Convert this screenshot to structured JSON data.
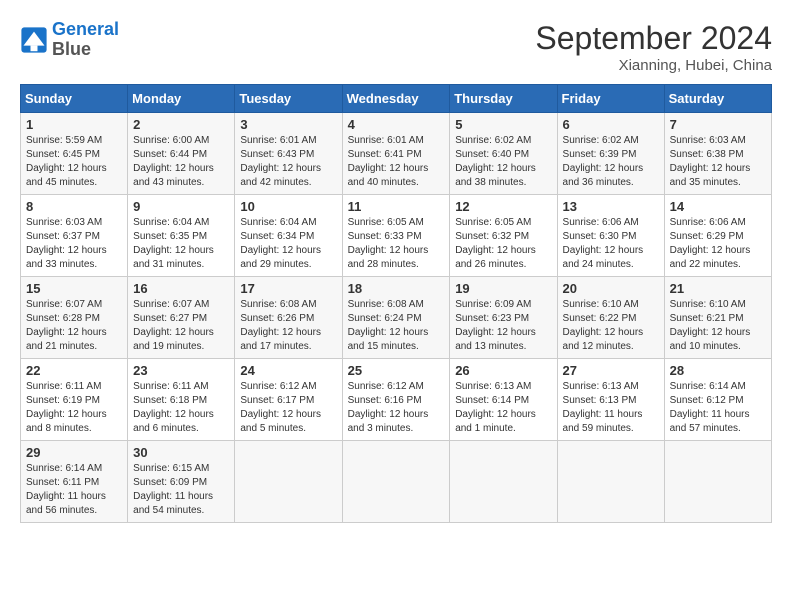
{
  "header": {
    "logo_line1": "General",
    "logo_line2": "Blue",
    "month_title": "September 2024",
    "location": "Xianning, Hubei, China"
  },
  "weekdays": [
    "Sunday",
    "Monday",
    "Tuesday",
    "Wednesday",
    "Thursday",
    "Friday",
    "Saturday"
  ],
  "weeks": [
    [
      {
        "day": "1",
        "sunrise": "Sunrise: 5:59 AM",
        "sunset": "Sunset: 6:45 PM",
        "daylight": "Daylight: 12 hours and 45 minutes."
      },
      {
        "day": "2",
        "sunrise": "Sunrise: 6:00 AM",
        "sunset": "Sunset: 6:44 PM",
        "daylight": "Daylight: 12 hours and 43 minutes."
      },
      {
        "day": "3",
        "sunrise": "Sunrise: 6:01 AM",
        "sunset": "Sunset: 6:43 PM",
        "daylight": "Daylight: 12 hours and 42 minutes."
      },
      {
        "day": "4",
        "sunrise": "Sunrise: 6:01 AM",
        "sunset": "Sunset: 6:41 PM",
        "daylight": "Daylight: 12 hours and 40 minutes."
      },
      {
        "day": "5",
        "sunrise": "Sunrise: 6:02 AM",
        "sunset": "Sunset: 6:40 PM",
        "daylight": "Daylight: 12 hours and 38 minutes."
      },
      {
        "day": "6",
        "sunrise": "Sunrise: 6:02 AM",
        "sunset": "Sunset: 6:39 PM",
        "daylight": "Daylight: 12 hours and 36 minutes."
      },
      {
        "day": "7",
        "sunrise": "Sunrise: 6:03 AM",
        "sunset": "Sunset: 6:38 PM",
        "daylight": "Daylight: 12 hours and 35 minutes."
      }
    ],
    [
      {
        "day": "8",
        "sunrise": "Sunrise: 6:03 AM",
        "sunset": "Sunset: 6:37 PM",
        "daylight": "Daylight: 12 hours and 33 minutes."
      },
      {
        "day": "9",
        "sunrise": "Sunrise: 6:04 AM",
        "sunset": "Sunset: 6:35 PM",
        "daylight": "Daylight: 12 hours and 31 minutes."
      },
      {
        "day": "10",
        "sunrise": "Sunrise: 6:04 AM",
        "sunset": "Sunset: 6:34 PM",
        "daylight": "Daylight: 12 hours and 29 minutes."
      },
      {
        "day": "11",
        "sunrise": "Sunrise: 6:05 AM",
        "sunset": "Sunset: 6:33 PM",
        "daylight": "Daylight: 12 hours and 28 minutes."
      },
      {
        "day": "12",
        "sunrise": "Sunrise: 6:05 AM",
        "sunset": "Sunset: 6:32 PM",
        "daylight": "Daylight: 12 hours and 26 minutes."
      },
      {
        "day": "13",
        "sunrise": "Sunrise: 6:06 AM",
        "sunset": "Sunset: 6:30 PM",
        "daylight": "Daylight: 12 hours and 24 minutes."
      },
      {
        "day": "14",
        "sunrise": "Sunrise: 6:06 AM",
        "sunset": "Sunset: 6:29 PM",
        "daylight": "Daylight: 12 hours and 22 minutes."
      }
    ],
    [
      {
        "day": "15",
        "sunrise": "Sunrise: 6:07 AM",
        "sunset": "Sunset: 6:28 PM",
        "daylight": "Daylight: 12 hours and 21 minutes."
      },
      {
        "day": "16",
        "sunrise": "Sunrise: 6:07 AM",
        "sunset": "Sunset: 6:27 PM",
        "daylight": "Daylight: 12 hours and 19 minutes."
      },
      {
        "day": "17",
        "sunrise": "Sunrise: 6:08 AM",
        "sunset": "Sunset: 6:26 PM",
        "daylight": "Daylight: 12 hours and 17 minutes."
      },
      {
        "day": "18",
        "sunrise": "Sunrise: 6:08 AM",
        "sunset": "Sunset: 6:24 PM",
        "daylight": "Daylight: 12 hours and 15 minutes."
      },
      {
        "day": "19",
        "sunrise": "Sunrise: 6:09 AM",
        "sunset": "Sunset: 6:23 PM",
        "daylight": "Daylight: 12 hours and 13 minutes."
      },
      {
        "day": "20",
        "sunrise": "Sunrise: 6:10 AM",
        "sunset": "Sunset: 6:22 PM",
        "daylight": "Daylight: 12 hours and 12 minutes."
      },
      {
        "day": "21",
        "sunrise": "Sunrise: 6:10 AM",
        "sunset": "Sunset: 6:21 PM",
        "daylight": "Daylight: 12 hours and 10 minutes."
      }
    ],
    [
      {
        "day": "22",
        "sunrise": "Sunrise: 6:11 AM",
        "sunset": "Sunset: 6:19 PM",
        "daylight": "Daylight: 12 hours and 8 minutes."
      },
      {
        "day": "23",
        "sunrise": "Sunrise: 6:11 AM",
        "sunset": "Sunset: 6:18 PM",
        "daylight": "Daylight: 12 hours and 6 minutes."
      },
      {
        "day": "24",
        "sunrise": "Sunrise: 6:12 AM",
        "sunset": "Sunset: 6:17 PM",
        "daylight": "Daylight: 12 hours and 5 minutes."
      },
      {
        "day": "25",
        "sunrise": "Sunrise: 6:12 AM",
        "sunset": "Sunset: 6:16 PM",
        "daylight": "Daylight: 12 hours and 3 minutes."
      },
      {
        "day": "26",
        "sunrise": "Sunrise: 6:13 AM",
        "sunset": "Sunset: 6:14 PM",
        "daylight": "Daylight: 12 hours and 1 minute."
      },
      {
        "day": "27",
        "sunrise": "Sunrise: 6:13 AM",
        "sunset": "Sunset: 6:13 PM",
        "daylight": "Daylight: 11 hours and 59 minutes."
      },
      {
        "day": "28",
        "sunrise": "Sunrise: 6:14 AM",
        "sunset": "Sunset: 6:12 PM",
        "daylight": "Daylight: 11 hours and 57 minutes."
      }
    ],
    [
      {
        "day": "29",
        "sunrise": "Sunrise: 6:14 AM",
        "sunset": "Sunset: 6:11 PM",
        "daylight": "Daylight: 11 hours and 56 minutes."
      },
      {
        "day": "30",
        "sunrise": "Sunrise: 6:15 AM",
        "sunset": "Sunset: 6:09 PM",
        "daylight": "Daylight: 11 hours and 54 minutes."
      },
      null,
      null,
      null,
      null,
      null
    ]
  ]
}
